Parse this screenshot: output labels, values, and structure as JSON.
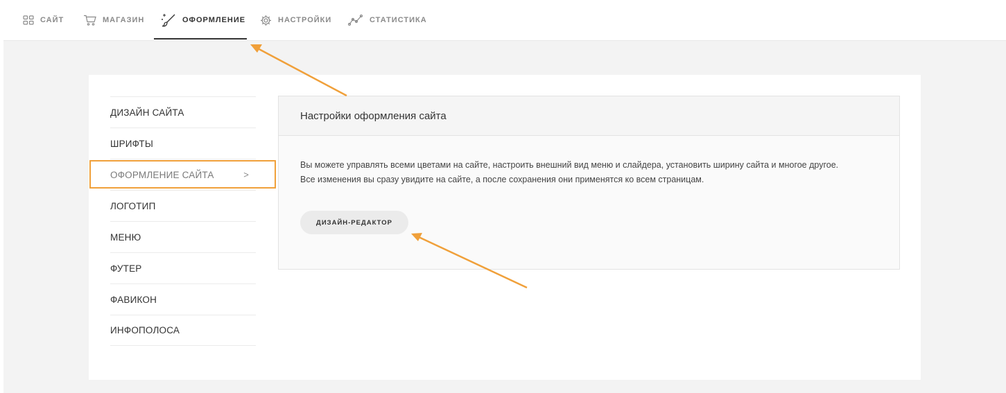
{
  "topnav": {
    "items": [
      {
        "label": "САЙТ",
        "icon": "grid-icon"
      },
      {
        "label": "МАГАЗИН",
        "icon": "cart-icon"
      },
      {
        "label": "ОФОРМЛЕНИЕ",
        "icon": "magic-brush-icon",
        "active": true
      },
      {
        "label": "НАСТРОЙКИ",
        "icon": "gear-icon"
      },
      {
        "label": "СТАТИСТИКА",
        "icon": "chart-line-icon"
      }
    ]
  },
  "side_menu": {
    "items": [
      {
        "label": "ДИЗАЙН САЙТА"
      },
      {
        "label": "ШРИФТЫ"
      },
      {
        "label": "ОФОРМЛЕНИЕ САЙТА",
        "selected": true,
        "chevron": ">"
      },
      {
        "label": "ЛОГОТИП"
      },
      {
        "label": "МЕНЮ"
      },
      {
        "label": "ФУТЕР"
      },
      {
        "label": "ФАВИКОН"
      },
      {
        "label": "ИНФОПОЛОСА"
      }
    ]
  },
  "panel": {
    "title": "Настройки оформления сайта",
    "description_line1": "Вы можете управлять всеми цветами на сайте, настроить внешний вид меню и слайдера, установить ширину сайта и многое другое.",
    "description_line2": "Все изменения вы сразу увидите на сайте, а после сохранения они применятся ко всем страницам.",
    "button_label": "ДИЗАЙН-РЕДАКТОР"
  },
  "colors": {
    "annotation": "#f0a03a",
    "active_underline": "#333333",
    "workspace_bg": "#f3f3f3"
  }
}
